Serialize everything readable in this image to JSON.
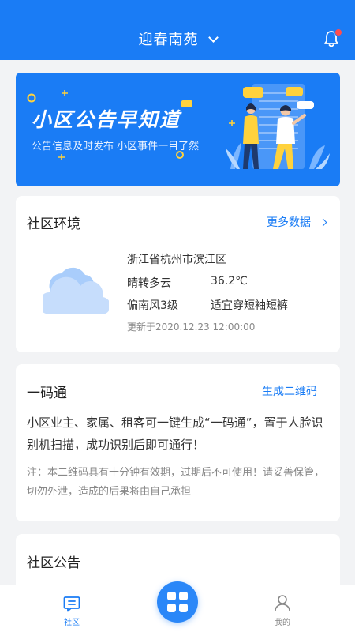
{
  "header": {
    "title": "迎春南苑"
  },
  "banner": {
    "title": "小区公告早知道",
    "subtitle": "公告信息及时发布  小区事件一目了然"
  },
  "environment": {
    "title": "社区环境",
    "more_label": "更多数据",
    "location": "浙江省杭州市滨江区",
    "weather": "晴转多云",
    "temperature": "36.2℃",
    "wind": "偏南风3级",
    "advice": "适宜穿短袖短裤",
    "updated": "更新于2020.12.23 12:00:00"
  },
  "qrcode": {
    "title": "一码通",
    "action_label": "生成二维码",
    "description": "小区业主、家属、租客可一键生成“一码通”，置于人脸识别机扫描，成功识别后即可通行！",
    "note": "注：本二维码具有十分钟有效期，过期后不可使用！请妥善保管，切勿外泄，造成的后果将由自己承担"
  },
  "notice": {
    "title": "社区公告"
  },
  "tabbar": {
    "home_label": "社区",
    "mine_label": "我的"
  },
  "colors": {
    "primary": "#1a7cf5",
    "badge": "#ff4d4f"
  }
}
